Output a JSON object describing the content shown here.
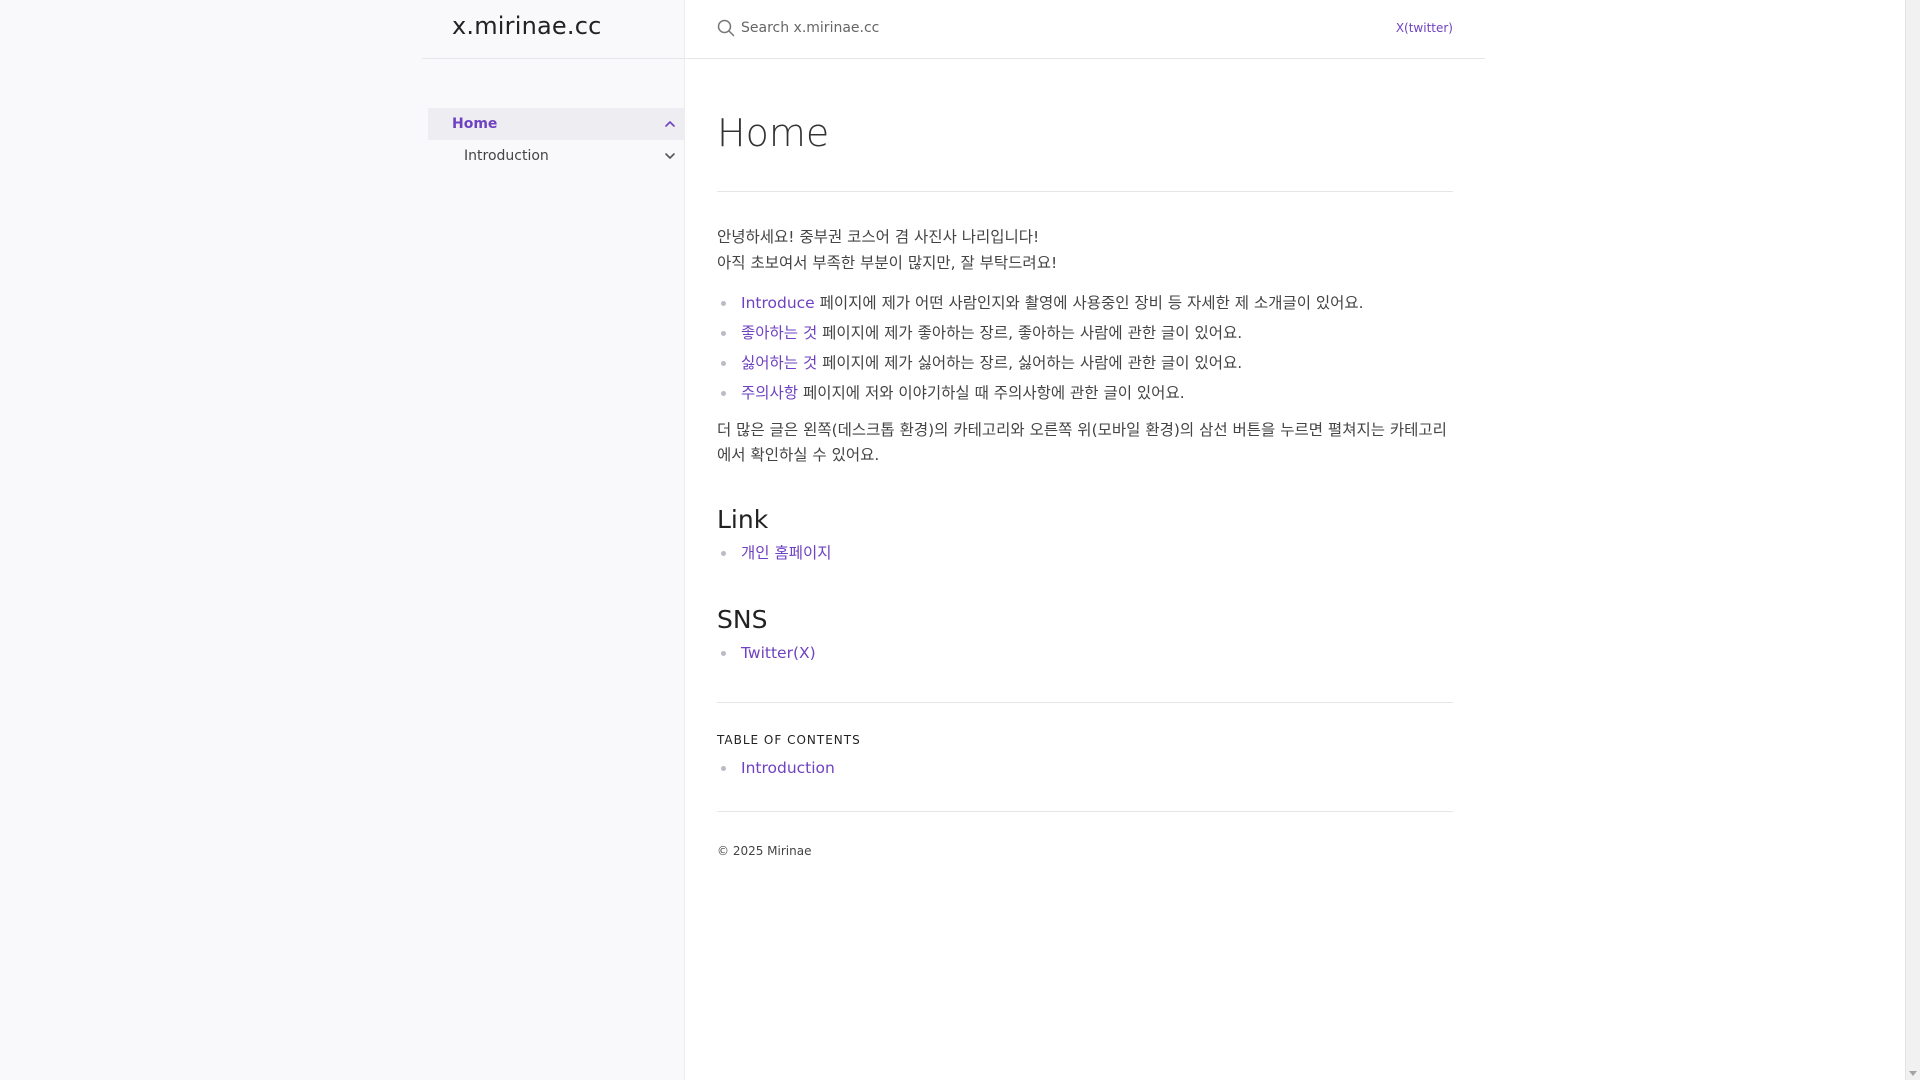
{
  "site": {
    "brand": "x.mirinae.cc"
  },
  "topbar": {
    "search_placeholder": "Search x.mirinae.cc",
    "aux_link": "X(twitter)"
  },
  "sidebar": {
    "items": [
      {
        "label": "Home",
        "active": true,
        "expanded": true
      },
      {
        "label": "Introduction",
        "active": false,
        "expanded": false
      }
    ]
  },
  "main": {
    "title": "Home",
    "intro_line1": "안녕하세요! 중부권 코스어 겸 사진사 나리입니다!",
    "intro_line2": "아직 초보여서 부족한 부분이 많지만, 잘 부탁드려요!",
    "bullets": [
      {
        "link": "Introduce",
        "text": " 페이지에 제가 어떤 사람인지와 촬영에 사용중인 장비 등 자세한 제 소개글이 있어요."
      },
      {
        "link": "좋아하는 것",
        "text": " 페이지에 제가 좋아하는 장르, 좋아하는 사람에 관한 글이 있어요."
      },
      {
        "link": "싫어하는 것",
        "text": " 페이지에 제가 싫어하는 장르, 싫어하는 사람에 관한 글이 있어요."
      },
      {
        "link": "주의사항",
        "text": " 페이지에 저와 이야기하실 때 주의사항에 관한 글이 있어요."
      }
    ],
    "more_text": "더 많은 글은 왼쪽(데스크톱 환경)의 카테고리와 오른쪽 위(모바일 환경)의 삼선 버튼을 누르면 펼쳐지는 카테고리에서 확인하실 수 있어요.",
    "link_section": {
      "heading": "Link",
      "items": [
        "개인 홈페이지"
      ]
    },
    "sns_section": {
      "heading": "SNS",
      "items": [
        "Twitter(X)"
      ]
    },
    "toc": {
      "heading": "TABLE OF CONTENTS",
      "items": [
        "Introduction"
      ]
    },
    "footer": "© 2025 Mirinae"
  },
  "icons": {
    "search": "search-icon",
    "expand": "chevron-icon"
  },
  "colors": {
    "accent": "#6f42c1",
    "sidebar_bg": "#f9f9fb",
    "active_bg": "#ededf2"
  }
}
